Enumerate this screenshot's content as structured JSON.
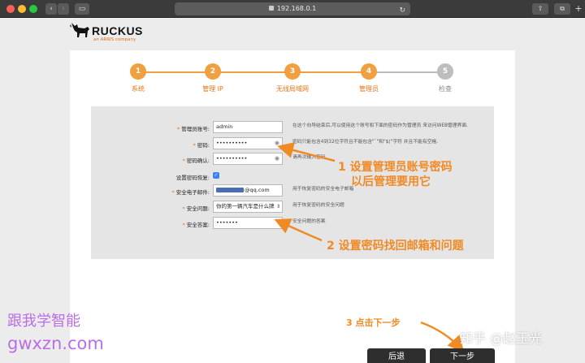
{
  "browser": {
    "url": "192.168.0.1",
    "back_label": "‹",
    "forward_label": "›",
    "reload_label": "↻"
  },
  "brand": {
    "name": "RUCKUS",
    "tagline": "an ARRIS company"
  },
  "steps": [
    {
      "number": "1",
      "label": "系统",
      "state": "done"
    },
    {
      "number": "2",
      "label": "管理 IP",
      "state": "done"
    },
    {
      "number": "3",
      "label": "无线局域网",
      "state": "done"
    },
    {
      "number": "4",
      "label": "管理员",
      "state": "active"
    },
    {
      "number": "5",
      "label": "检查",
      "state": "pending"
    }
  ],
  "form": {
    "admin_name": {
      "label": "管理员账号:",
      "value": "admin",
      "hint": "在这个向导结束后,可以使用这个账号和下面的密码作为管理员 来访问WEB管理界面."
    },
    "password": {
      "label": "密码:",
      "value": "••••••••••",
      "hint": "密码只能包含4到32位字符且不能包含\"`\"和\"$(\"字符 并且不能有空格."
    },
    "confirm": {
      "label": "密码确认:",
      "value": "••••••••••",
      "hint": "请再次输入密码."
    },
    "recovery": {
      "label": "设置密码恢复:",
      "checked": "✓"
    },
    "email": {
      "label": "安全电子邮件:",
      "value": "@qq.com",
      "hint": "用于恢复密码的安全电子邮箱"
    },
    "question": {
      "label": "安全问题:",
      "value": "你的第一辆汽车是什么牌",
      "hint": "用于恢复密码的安全问题"
    },
    "answer": {
      "label": "安全答案:",
      "value": "•••••••",
      "hint": "安全问题的答案"
    }
  },
  "annotations": {
    "a1_line1": "1 设置管理员账号密码",
    "a1_line2": "以后管理要用它",
    "a2": "2 设置密码找回邮箱和问题",
    "a3": "3 点击下一步"
  },
  "watermarks": {
    "wm1": "跟我学智能",
    "wm2": "gwxzn.com",
    "wm3": "知乎 @赵玉光"
  },
  "buttons": {
    "back": "后退",
    "next": "下一步"
  },
  "colors": {
    "accent": "#f0a040",
    "accent_text": "#e6731a",
    "pending": "#bdbdbd",
    "annotation": "#f08a24",
    "watermark": "#b96ee6"
  }
}
